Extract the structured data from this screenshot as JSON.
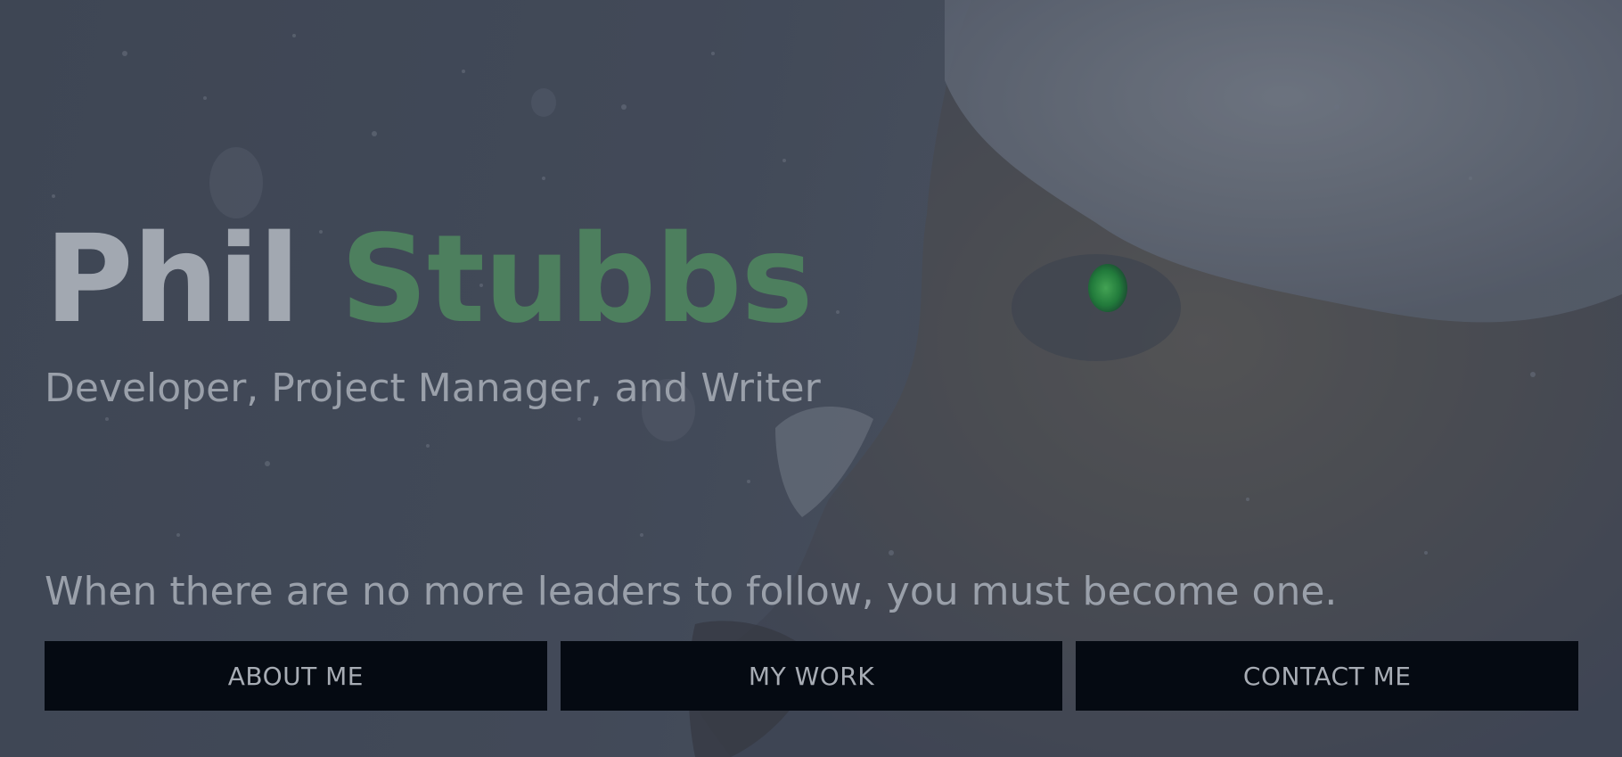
{
  "hero": {
    "first_name": "Phil",
    "last_name": "Stubbs",
    "tagline": "Developer, Project Manager, and Writer",
    "quote": "When there are no more leaders to follow, you must become one."
  },
  "nav": {
    "buttons": [
      {
        "label": "ABOUT ME"
      },
      {
        "label": "MY WORK"
      },
      {
        "label": "CONTACT ME"
      }
    ]
  },
  "colors": {
    "accent": "#4d7f5e",
    "text_muted": "#a2a8b1",
    "button_bg": "#050a12",
    "wolf_eye": "#2fb84a"
  },
  "background": {
    "image_subject": "snow-covered-wolf-icon"
  }
}
